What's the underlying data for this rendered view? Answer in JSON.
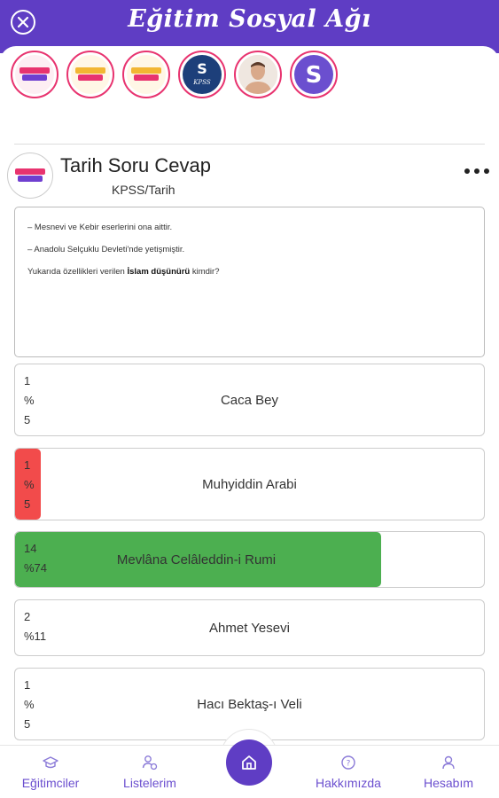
{
  "header": {
    "title": "Eğitim Sosyal Ağı",
    "close_icon": "close-icon"
  },
  "post": {
    "title": "Tarih Soru Cevap",
    "category": "KPSS/Tarih",
    "question_lines": [
      "–  Mesnevi ve Kebir eserlerini ona aittir.",
      "–  Anadolu Selçuklu Devleti'nde yetişmiştir."
    ],
    "question_prefix": "Yukarıda özellikleri verilen ",
    "question_bold": "İslam düşünürü",
    "question_suffix": " kimdir?"
  },
  "options": [
    {
      "count": "1",
      "pct_sign": "%",
      "pct": "5",
      "percent_text": "",
      "label": "Caca Bey",
      "fill_fraction": 0,
      "fill_color": ""
    },
    {
      "count": "1",
      "pct_sign": "%",
      "pct": "5",
      "percent_text": "",
      "label": "Muhyiddin Arabi",
      "fill_fraction": 0.055,
      "fill_color": "#f24b4b"
    },
    {
      "count": "14",
      "pct_sign": "",
      "pct": "",
      "percent_text": "%74",
      "label": "Mevlâna Celâleddin-i Rumi",
      "fill_fraction": 0.78,
      "fill_color": "#4caf50"
    },
    {
      "count": "2",
      "pct_sign": "",
      "pct": "",
      "percent_text": "%11",
      "label": "Ahmet Yesevi",
      "fill_fraction": 0,
      "fill_color": ""
    },
    {
      "count": "1",
      "pct_sign": "%",
      "pct": "5",
      "percent_text": "",
      "label": "Hacı Bektaş-ı Veli",
      "fill_fraction": 0,
      "fill_color": ""
    }
  ],
  "nav": {
    "educators": "Eğitimciler",
    "lists": "Listelerim",
    "about": "Hakkımızda",
    "account": "Hesabım"
  },
  "colors": {
    "brand": "#5f3dc4",
    "correct": "#4caf50",
    "wrong": "#f24b4b",
    "story_ring": "#e8336f"
  }
}
